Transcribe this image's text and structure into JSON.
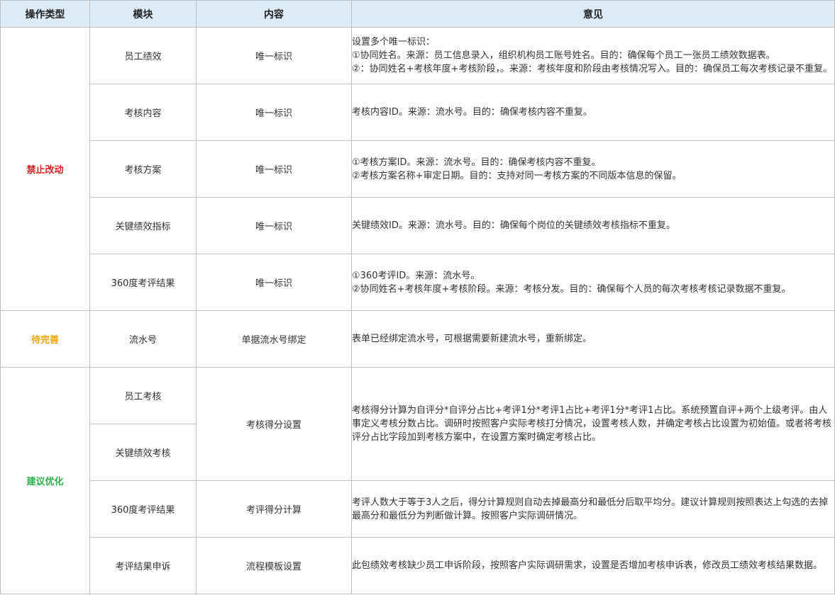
{
  "headers": {
    "type": "操作类型",
    "module": "模块",
    "content": "内容",
    "opinion": "意见"
  },
  "colors": {
    "header_bg": "#ddebf7",
    "forbidden": "#e02020",
    "pending": "#f0a500",
    "suggest": "#2bb24c"
  },
  "groups": [
    {
      "type": "禁止改动",
      "rows": [
        {
          "module": "员工绩效",
          "content": "唯一标识",
          "opinion": [
            "设置多个唯一标识：",
            "①协同姓名。来源：员工信息录入，组织机构员工账号姓名。目的：确保每个员工一张员工绩效数据表。",
            "②：协同姓名+考核年度+考核阶段，。来源：考核年度和阶段由考核情况写入。目的：确保员工每次考核记录不重复。"
          ]
        },
        {
          "module": "考核内容",
          "content": "唯一标识",
          "opinion": [
            "考核内容ID。来源：流水号。目的：确保考核内容不重复。"
          ]
        },
        {
          "module": "考核方案",
          "content": "唯一标识",
          "opinion": [
            "①考核方案ID。来源：流水号。目的：确保考核内容不重复。",
            "②考核方案名称+审定日期。目的：支持对同一考核方案的不同版本信息的保留。"
          ]
        },
        {
          "module": "关键绩效指标",
          "content": "唯一标识",
          "opinion": [
            "关键绩效ID。来源：流水号。目的：确保每个岗位的关键绩效考核指标不重复。"
          ]
        },
        {
          "module": "360度考评结果",
          "content": "唯一标识",
          "opinion": [
            "①360考评ID。来源：流水号。",
            "②协同姓名+考核年度+考核阶段。来源：考核分发。目的：确保每个人员的每次考核考核记录数据不重复。"
          ]
        }
      ]
    },
    {
      "type": "待完善",
      "rows": [
        {
          "module": "流水号",
          "content": "单据流水号绑定",
          "opinion": [
            "表单已经绑定流水号，可根据需要新建流水号，重新绑定。"
          ]
        }
      ]
    },
    {
      "type": "建议优化",
      "rows": [
        {
          "module": "员工考核",
          "content": "考核得分设置",
          "opinion": [
            "考核得分计算为自评分*自评分占比+考评1分*考评1占比+考评1分*考评1占比。系统预置自评+两个上级考评。由人事定义考核分数占比。调研时按照客户实际考核打分情况，设置考核人数，并确定考核占比设置为初始值。或者将考核评分占比字段加到考核方案中，在设置方案时确定考核占比。"
          ]
        },
        {
          "module": "关键绩效考核"
        },
        {
          "module": "360度考评结果",
          "content": "考评得分计算",
          "opinion": [
            "考评人数大于等于3人之后，得分计算规则自动去掉最高分和最低分后取平均分。建议计算规则按照表达上勾选的去掉最高分和最低分为判断做计算。按照客户实际调研情况。"
          ]
        },
        {
          "module": "考评结果申诉",
          "content": "流程模板设置",
          "opinion": [
            "此包绩效考核缺少员工申诉阶段，按照客户实际调研需求，设置是否增加考核申诉表，修改员工绩效考核结果数据。"
          ]
        }
      ]
    }
  ]
}
